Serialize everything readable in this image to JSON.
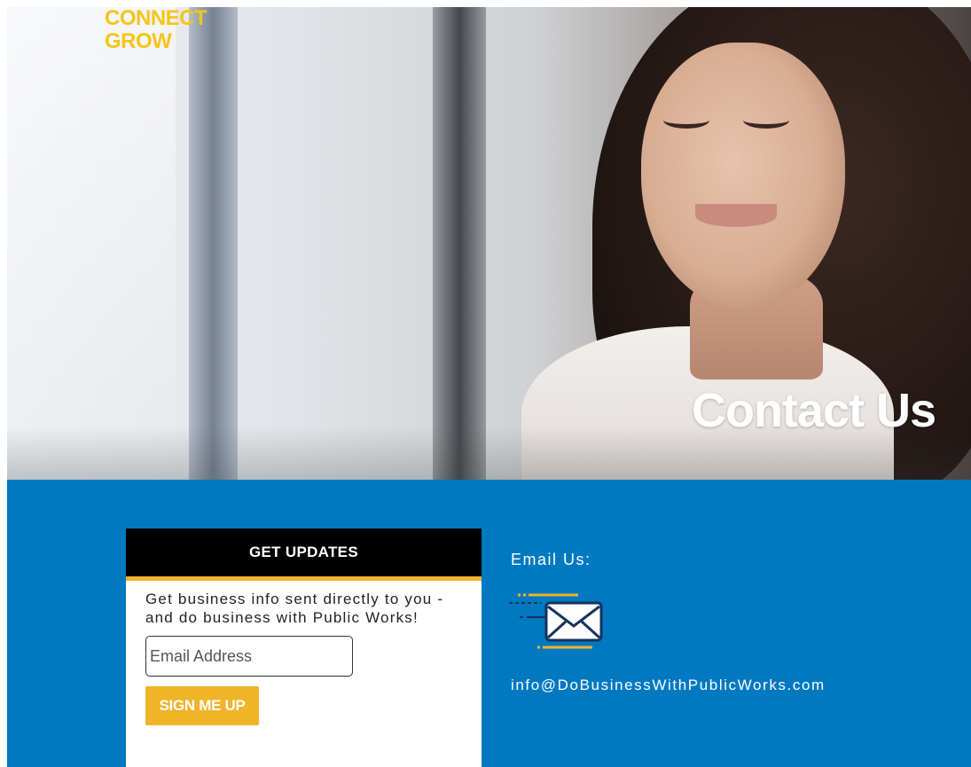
{
  "header": {
    "logo_lines": [
      "CONNECT",
      "GROW"
    ],
    "page_title": "Contact Us"
  },
  "signup": {
    "heading": "GET UPDATES",
    "description": "Get business info sent directly to you - and do business with Public Works!",
    "email_placeholder": "Email Address",
    "email_value": "",
    "button_label": "SIGN ME UP"
  },
  "contact": {
    "email_label": "Email Us:",
    "email_icon": "envelope-icon",
    "email_address": "info@DoBusinessWithPublicWorks.com"
  },
  "colors": {
    "brand_blue": "#0079c1",
    "accent_gold": "#f0b429",
    "logo_yellow": "#f5c518",
    "card_header": "#000000"
  }
}
